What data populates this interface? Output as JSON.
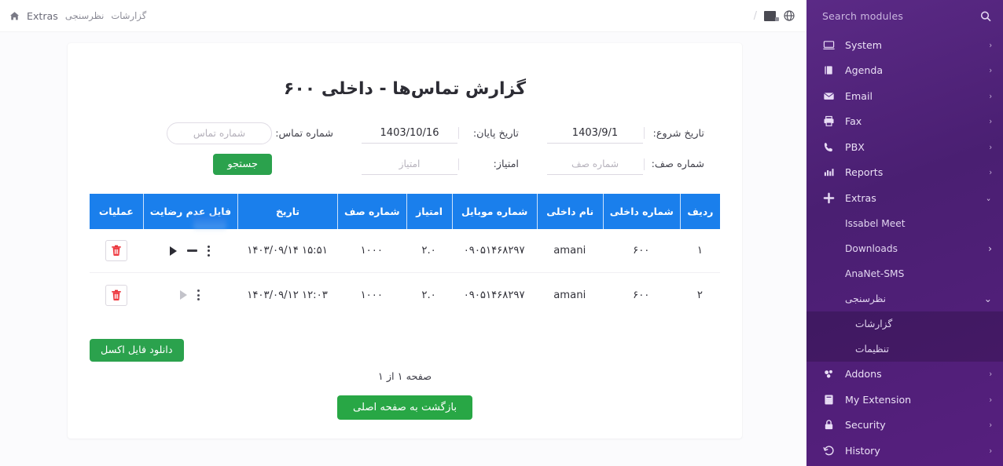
{
  "sidebar": {
    "search_placeholder": "Search modules",
    "search_icon": "search-icon",
    "items": [
      {
        "label": "System",
        "icon": "monitor-icon",
        "chevron": "›"
      },
      {
        "label": "Agenda",
        "icon": "book-icon",
        "chevron": "›"
      },
      {
        "label": "Email",
        "icon": "envelope-icon",
        "chevron": "›"
      },
      {
        "label": "Fax",
        "icon": "printer-icon",
        "chevron": "›"
      },
      {
        "label": "PBX",
        "icon": "phone-icon",
        "chevron": "›"
      },
      {
        "label": "Reports",
        "icon": "bar-chart-icon",
        "chevron": "›"
      },
      {
        "label": "Extras",
        "icon": "plus-icon",
        "chevron": "⌄"
      }
    ],
    "extras_children": [
      {
        "label": "Issabel Meet",
        "chevron": ""
      },
      {
        "label": "Downloads",
        "chevron": "›"
      },
      {
        "label": "AnaNet-SMS",
        "chevron": ""
      },
      {
        "label": "نظرسنجی",
        "chevron": "⌄",
        "rtl": true
      }
    ],
    "survey_children": [
      {
        "label": "گزارشات",
        "rtl": true
      },
      {
        "label": "تنظیمات",
        "rtl": true
      }
    ],
    "items_bottom": [
      {
        "label": "Addons",
        "icon": "puzzle-icon",
        "chevron": "›"
      },
      {
        "label": "My Extension",
        "icon": "calculator-icon",
        "chevron": "›"
      },
      {
        "label": "Security",
        "icon": "lock-icon",
        "chevron": "›"
      },
      {
        "label": "History",
        "icon": "history-icon",
        "chevron": "›"
      }
    ]
  },
  "topbar": {
    "home_icon": "home-icon",
    "crumbs": [
      {
        "label": "Extras",
        "fa": false
      },
      {
        "label": "نظرسنجی",
        "fa": true
      },
      {
        "label": "گزارشات",
        "fa": true
      }
    ],
    "divider": "/",
    "notif_icon": "notification-square-icon",
    "globe_icon": "globe-icon"
  },
  "page": {
    "title": "گزارش تماس‌ها - داخلی ۶۰۰"
  },
  "form": {
    "start_date_label": "تاریخ شروع:",
    "start_date_value": "1403/9/1",
    "end_date_label": "تاریخ پایان:",
    "end_date_value": "1403/10/16",
    "call_number_label": "شماره تماس:",
    "call_number_placeholder": "شماره تماس",
    "call_number_value": "",
    "queue_label": "شماره صف:",
    "queue_placeholder": "شماره صف",
    "queue_value": "",
    "score_label": "امتیاز:",
    "score_placeholder": "امتیاز",
    "score_value": "",
    "search_button": "جستجو"
  },
  "table": {
    "headers": [
      "ردیف",
      "شماره داخلی",
      "نام داخلی",
      "شماره موبایل",
      "امتیاز",
      "شماره صف",
      "تاریخ",
      "فایل عدم رضایت",
      "عملیات"
    ],
    "rows": [
      {
        "index": "۱",
        "extension": "۶۰۰",
        "name": "amani",
        "mobile": "۰۹۰۵۱۴۶۸۲۹۷",
        "score": "۲.۰",
        "queue": "۱۰۰۰",
        "date": "۱۵:۵۱ ۱۴۰۳/۰۹/۱۴",
        "player_enabled": true,
        "has_duration_dash": true,
        "delete_icon": "trash-icon",
        "menu_icon": "kebab-menu-icon",
        "play_icon": "play-icon"
      },
      {
        "index": "۲",
        "extension": "۶۰۰",
        "name": "amani",
        "mobile": "۰۹۰۵۱۴۶۸۲۹۷",
        "score": "۲.۰",
        "queue": "۱۰۰۰",
        "date": "۱۲:۰۳ ۱۴۰۳/۰۹/۱۲",
        "player_enabled": false,
        "has_duration_dash": false,
        "delete_icon": "trash-icon",
        "menu_icon": "kebab-menu-icon",
        "play_icon": "play-icon"
      }
    ]
  },
  "footer": {
    "excel_button": "دانلود فایل اکسل",
    "page_info": "صفحه ۱ از ۱",
    "home_button": "بازگشت به صفحه اصلی"
  },
  "colors": {
    "sidebar": "#522580",
    "table_header": "#1a7fec",
    "green": "#2ba24d",
    "delete_red": "#e8262e"
  }
}
